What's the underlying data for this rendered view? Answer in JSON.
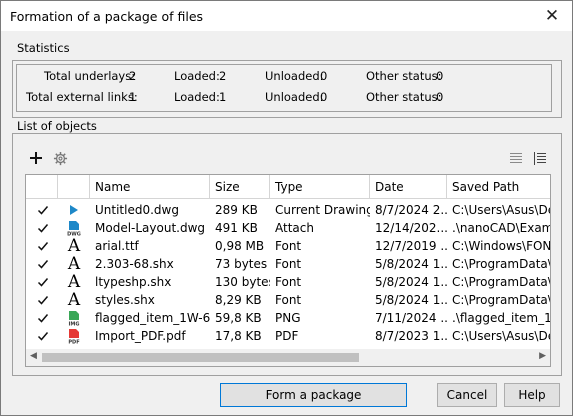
{
  "window": {
    "title": "Formation of a package of files",
    "close_glyph": "✕"
  },
  "statistics": {
    "label": "Statistics",
    "row1": [
      {
        "label": "Total underlays:",
        "value": "2"
      },
      {
        "label": "Loaded:",
        "value": "2"
      },
      {
        "label": "Unloaded:",
        "value": "0"
      },
      {
        "label": "Other status:",
        "value": "0"
      }
    ],
    "row2": [
      {
        "label": "Total external links:",
        "value": "1"
      },
      {
        "label": "Loaded:",
        "value": "1"
      },
      {
        "label": "Unloaded:",
        "value": "0"
      },
      {
        "label": "Other status:",
        "value": "0"
      }
    ]
  },
  "list": {
    "label": "List of objects",
    "toolbar": {
      "add_icon": "plus-icon",
      "settings_icon": "gear-icon",
      "view1_icon": "list-view-icon",
      "view2_icon": "tree-view-icon"
    },
    "columns": [
      "",
      "",
      "Name",
      "Size",
      "Type",
      "Date",
      "Saved Path"
    ],
    "rows": [
      {
        "icon": "play-icon",
        "name": "Untitled0.dwg",
        "size": "289 KB",
        "type": "Current Drawing",
        "date": "8/7/2024 2...",
        "path": "C:\\Users\\Asus\\Des"
      },
      {
        "icon": "dwg-file-icon",
        "name": "Model-Layout.dwg",
        "size": "491 KB",
        "type": "Attach",
        "date": "12/14/202...",
        "path": ".\\nanoCAD\\Examp"
      },
      {
        "icon": "font-icon",
        "name": "arial.ttf",
        "size": "0,98 MB",
        "type": "Font",
        "date": "12/7/2019 ...",
        "path": "C:\\Windows\\FONT"
      },
      {
        "icon": "font-icon",
        "name": "2.303-68.shx",
        "size": "73 bytes",
        "type": "Font",
        "date": "5/8/2024 1...",
        "path": "C:\\ProgramData\\N"
      },
      {
        "icon": "font-icon",
        "name": "ltypeshp.shx",
        "size": "130 bytes",
        "type": "Font",
        "date": "5/8/2024 1...",
        "path": "C:\\ProgramData\\N"
      },
      {
        "icon": "font-icon",
        "name": "styles.shx",
        "size": "8,29 KB",
        "type": "Font",
        "date": "5/8/2024 1...",
        "path": "C:\\ProgramData\\N"
      },
      {
        "icon": "img-file-icon",
        "name": "flagged_item_1W-6...",
        "size": "59,8 KB",
        "type": "PNG",
        "date": "7/11/2024 ...",
        "path": ".\\flagged_item_1W"
      },
      {
        "icon": "pdf-file-icon",
        "name": "Import_PDF.pdf",
        "size": "17,8 KB",
        "type": "PDF",
        "date": "8/7/2023 1...",
        "path": "C:\\Users\\Asus\\Des"
      }
    ],
    "file_icon_labels": {
      "dwg": "DWG",
      "img": "IMG",
      "pdf": "PDF"
    }
  },
  "buttons": {
    "form": "Form a package",
    "cancel": "Cancel",
    "help": "Help"
  },
  "colors": {
    "dwg_blue": "#1e88c8",
    "img_green": "#3aa757",
    "pdf_red": "#e53935"
  }
}
